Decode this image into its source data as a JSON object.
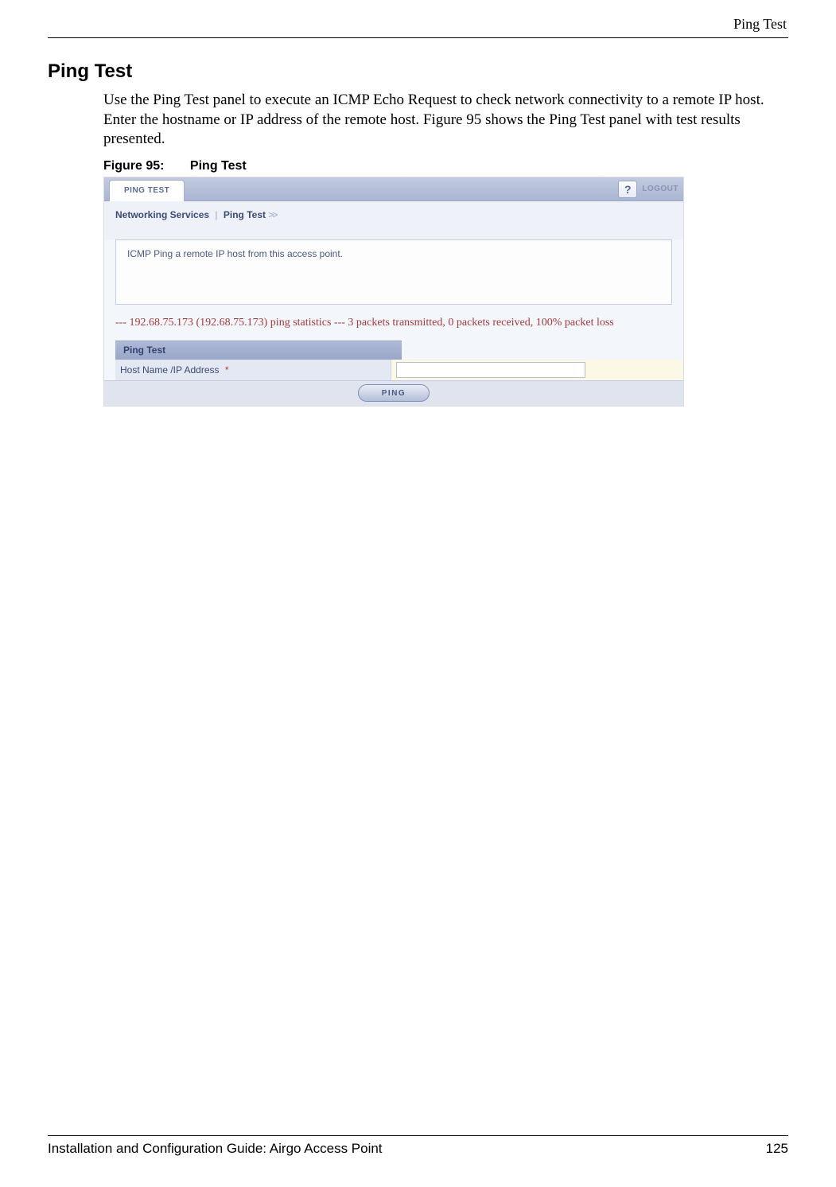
{
  "page": {
    "header_right": "Ping Test",
    "section_heading": "Ping Test",
    "body_paragraph": "Use the Ping Test panel to execute an ICMP Echo Request to check network connectivity to a remote IP host. Enter the hostname or IP address of the remote host. Figure 95 shows the Ping Test panel with test results presented.",
    "figure_label": "Figure 95:",
    "figure_title": "Ping Test"
  },
  "screenshot": {
    "tab_label": "PING TEST",
    "help_label": "?",
    "logout_label": "LOGOUT",
    "breadcrumb_part1": "Networking Services",
    "breadcrumb_sep": "|",
    "breadcrumb_part2": "Ping Test",
    "breadcrumb_arrows": ">>",
    "description": "ICMP Ping a remote IP host from this access point.",
    "result_text": "--- 192.68.75.173 (192.68.75.173) ping statistics --- 3 packets transmitted, 0 packets received, 100% packet loss",
    "section_header": "Ping Test",
    "field_label": "Host Name /IP Address",
    "required_mark": "*",
    "input_value": "",
    "ping_button": "PING"
  },
  "footer": {
    "left": "Installation and Configuration Guide: Airgo Access Point",
    "right": "125"
  }
}
